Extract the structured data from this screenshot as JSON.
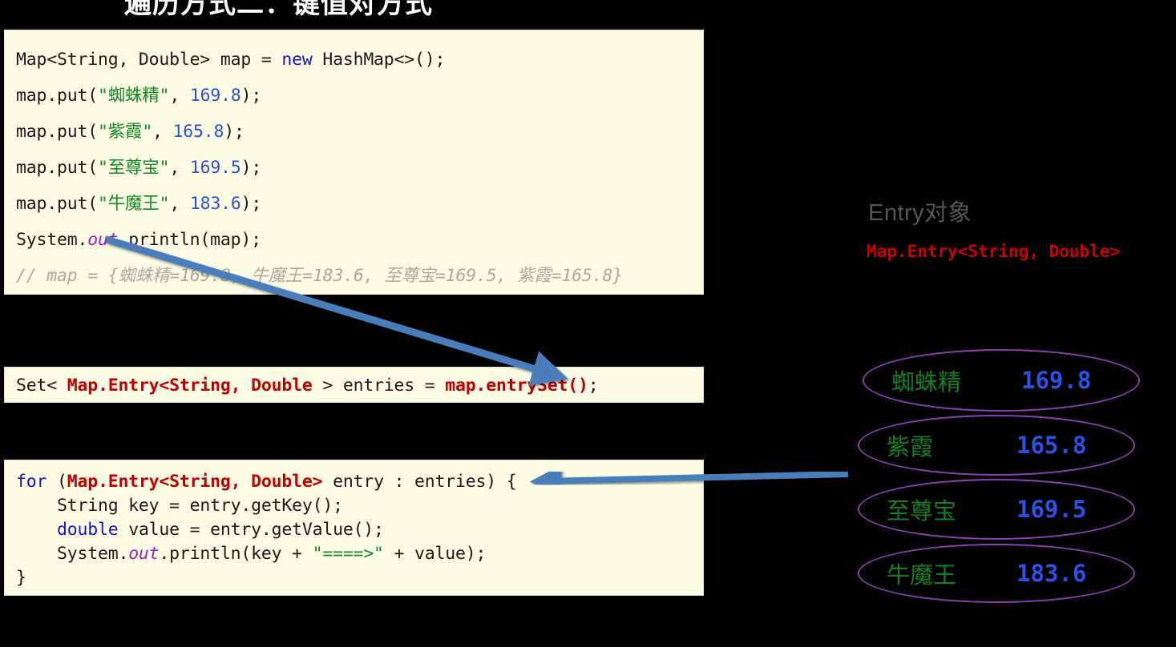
{
  "slide": {
    "title": "遍历方式二：键值对方式",
    "background_color": "#000000"
  },
  "colors": {
    "code_background": "#fdfce4",
    "keyword": "#1414c8",
    "number": "#2c4fd6",
    "string": "#128a28",
    "comment": "#a9a9a0",
    "entry_type": "#c00000",
    "oval_border": "#8c3fb0",
    "oval_key": "#118022",
    "oval_value": "#2a52e8",
    "arrow": "#4a7ebb",
    "heading": "#555555"
  },
  "panel_main": {
    "name": "map-creation-code",
    "lines": [
      [
        {
          "t": "Map<String, Double> map = ",
          "c": "plain"
        },
        {
          "t": "new",
          "c": "kw"
        },
        {
          "t": " HashMap<>();",
          "c": "plain"
        }
      ],
      [
        {
          "t": "map.put(",
          "c": "plain"
        },
        {
          "t": "\"",
          "c": "str"
        },
        {
          "t": "蜘蛛精",
          "c": "str-cn"
        },
        {
          "t": "\"",
          "c": "str"
        },
        {
          "t": ", ",
          "c": "plain"
        },
        {
          "t": "169.8",
          "c": "num"
        },
        {
          "t": ");",
          "c": "plain"
        }
      ],
      [
        {
          "t": "map.put(",
          "c": "plain"
        },
        {
          "t": "\"",
          "c": "str"
        },
        {
          "t": "紫霞",
          "c": "str-cn"
        },
        {
          "t": "\"",
          "c": "str"
        },
        {
          "t": ", ",
          "c": "plain"
        },
        {
          "t": "165.8",
          "c": "num"
        },
        {
          "t": ");",
          "c": "plain"
        }
      ],
      [
        {
          "t": "map.put(",
          "c": "plain"
        },
        {
          "t": "\"",
          "c": "str"
        },
        {
          "t": "至尊宝",
          "c": "str-cn"
        },
        {
          "t": "\"",
          "c": "str"
        },
        {
          "t": ", ",
          "c": "plain"
        },
        {
          "t": "169.5",
          "c": "num"
        },
        {
          "t": ");",
          "c": "plain"
        }
      ],
      [
        {
          "t": "map.put(",
          "c": "plain"
        },
        {
          "t": "\"",
          "c": "str"
        },
        {
          "t": "牛魔王",
          "c": "str-cn"
        },
        {
          "t": "\"",
          "c": "str"
        },
        {
          "t": ", ",
          "c": "plain"
        },
        {
          "t": "183.6",
          "c": "num"
        },
        {
          "t": ");",
          "c": "plain"
        }
      ],
      [
        {
          "t": "System.",
          "c": "plain"
        },
        {
          "t": "out",
          "c": "field-out"
        },
        {
          "t": ".println(map);",
          "c": "plain"
        }
      ],
      [
        {
          "t": "// map = {蜘蛛精=169.8, 牛魔王=183.6, 至尊宝=169.5, 紫霞=165.8}",
          "c": "comment"
        }
      ]
    ]
  },
  "panel_entry": {
    "name": "entryset-code",
    "lines": [
      [
        {
          "t": "Set< ",
          "c": "plain"
        },
        {
          "t": "Map.Entry<String, Double",
          "c": "entrytype"
        },
        {
          "t": " > entries = ",
          "c": "plain"
        },
        {
          "t": "map.entrySet()",
          "c": "redcall"
        },
        {
          "t": ";",
          "c": "plain"
        }
      ]
    ]
  },
  "panel_foreach": {
    "name": "foreach-loop-code",
    "lines": [
      [
        {
          "t": "for",
          "c": "kw"
        },
        {
          "t": " (",
          "c": "plain"
        },
        {
          "t": "Map.Entry<String, Double>",
          "c": "entrytype"
        },
        {
          "t": " entry : entries) {",
          "c": "plain"
        }
      ],
      [
        {
          "t": "    String key = entry.getKey();",
          "c": "plain"
        }
      ],
      [
        {
          "t": "    ",
          "c": "plain"
        },
        {
          "t": "double",
          "c": "kw"
        },
        {
          "t": " value = entry.getValue();",
          "c": "plain"
        }
      ],
      [
        {
          "t": "    System.",
          "c": "plain"
        },
        {
          "t": "out",
          "c": "field-out"
        },
        {
          "t": ".println(key + ",
          "c": "plain"
        },
        {
          "t": "\"====>\"",
          "c": "str"
        },
        {
          "t": " + value);",
          "c": "plain"
        }
      ],
      [
        {
          "t": "}",
          "c": "plain"
        }
      ]
    ]
  },
  "right_panel": {
    "heading": "Entry对象",
    "signature": "Map.Entry<String, Double>"
  },
  "entries": [
    {
      "key": "蜘蛛精",
      "value": "169.8"
    },
    {
      "key": "紫霞",
      "value": "165.8"
    },
    {
      "key": "至尊宝",
      "value": "169.5"
    },
    {
      "key": "牛魔王",
      "value": "183.6"
    }
  ],
  "arrows": [
    {
      "name": "arrow-println-to-entryset",
      "from": "System.out.println(map);",
      "to": "map.entrySet();"
    },
    {
      "name": "arrow-entryset-to-first-entry",
      "from": "map.entrySet();",
      "to": "蜘蛛精 169.8"
    },
    {
      "name": "arrow-entries-to-foreach",
      "from": "entry ovals",
      "to": "for (Map.Entry<String, Double> entry : entries) {"
    }
  ]
}
